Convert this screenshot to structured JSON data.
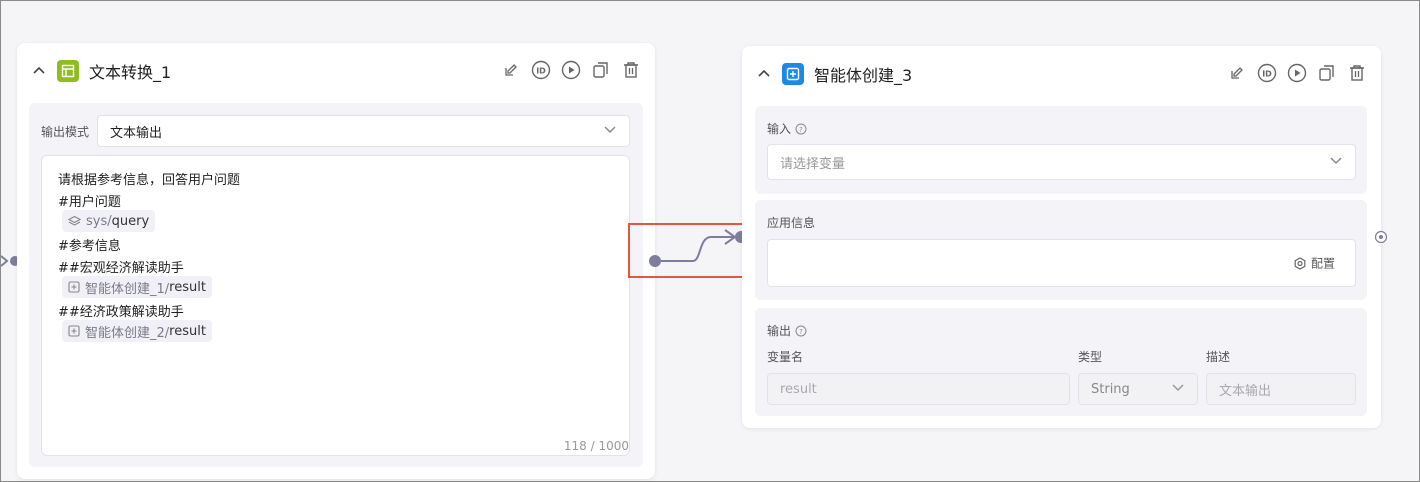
{
  "left_node": {
    "title": "文本转换_1",
    "output_mode_label": "输出模式",
    "output_mode_value": "文本输出",
    "editor": {
      "line1": "请根据参考信息，回答用户问题",
      "line2": "#用户问题",
      "tag1_prefix": "sys/",
      "tag1_name": "query",
      "line3": "#参考信息",
      "line4": "##宏观经济解读助手",
      "tag2_prefix": "智能体创建_1/",
      "tag2_name": "result",
      "line5": "##经济政策解读助手",
      "tag3_prefix": "智能体创建_2/",
      "tag3_name": "result",
      "counter": "118 / 1000"
    }
  },
  "right_node": {
    "title": "智能体创建_3",
    "input_label": "输入",
    "input_placeholder": "请选择变量",
    "app_info_label": "应用信息",
    "config_label": "配置",
    "output_label": "输出",
    "col_var": "变量名",
    "col_type": "类型",
    "col_desc": "描述",
    "var_value": "result",
    "type_value": "String",
    "desc_value": "文本输出"
  },
  "colors": {
    "text_node_icon": "#8fbc1f",
    "agent_node_icon": "#1e88e5",
    "highlight": "#e8553e",
    "connector": "#7c7e9c"
  }
}
